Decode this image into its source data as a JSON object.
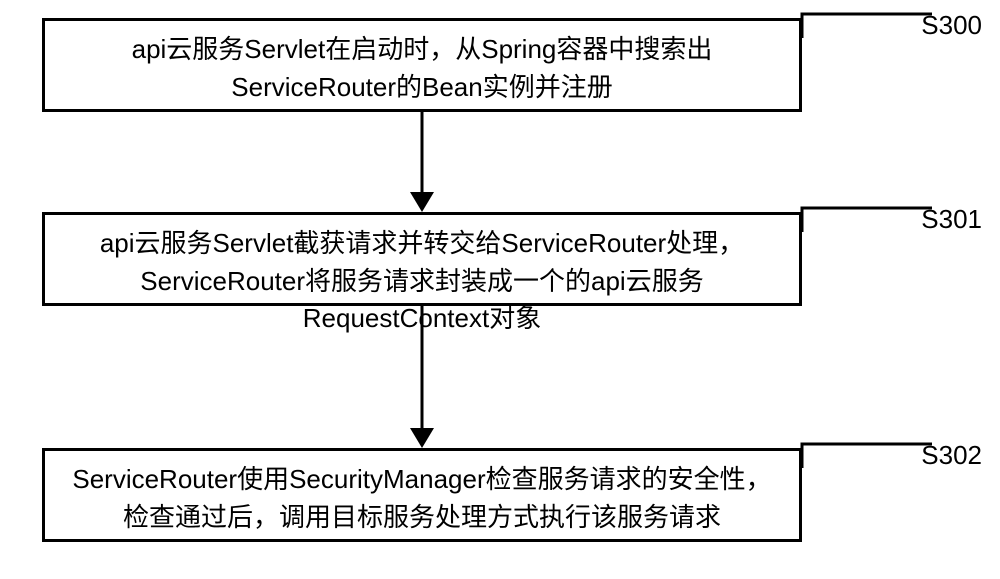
{
  "chart_data": {
    "type": "area",
    "title": "",
    "xlabel": "",
    "ylabel": "",
    "series": [],
    "steps": [
      {
        "id": "S300",
        "text": "api云服务Servlet在启动时，从Spring容器中搜索出ServiceRouter的Bean实例并注册"
      },
      {
        "id": "S301",
        "text": "api云服务Servlet截获请求并转交给ServiceRouter处理，ServiceRouter将服务请求封装成一个的api云服务RequestContext对象"
      },
      {
        "id": "S302",
        "text": "ServiceRouter使用SecurityManager检查服务请求的安全性，检查通过后，调用目标服务处理方式执行该服务请求"
      }
    ]
  },
  "labels": {
    "s0": "S300",
    "s1": "S301",
    "s2": "S302"
  },
  "boxes": {
    "b0": "api云服务Servlet在启动时，从Spring容器中搜索出ServiceRouter的Bean实例并注册",
    "b1": "api云服务Servlet截获请求并转交给ServiceRouter处理，ServiceRouter将服务请求封装成一个的api云服务RequestContext对象",
    "b2": "ServiceRouter使用SecurityManager检查服务请求的安全性，检查通过后，调用目标服务处理方式执行该服务请求"
  }
}
